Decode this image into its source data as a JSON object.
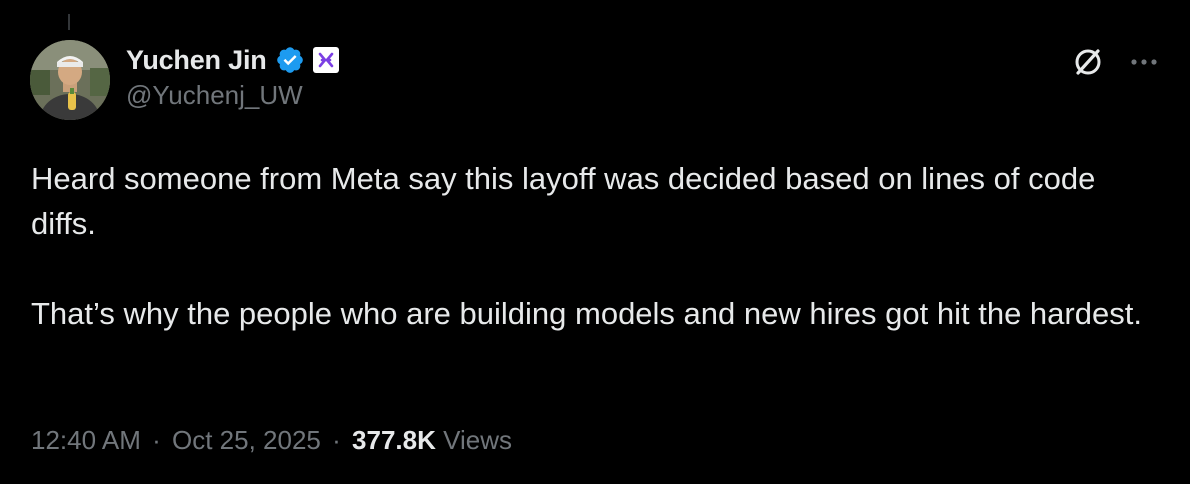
{
  "tweet": {
    "author": {
      "display_name": "Yuchen Jin",
      "handle": "@Yuchenj_UW",
      "verified": true,
      "verified_color": "#1d9bf0",
      "affiliate_badge_color": "#7b3fe4"
    },
    "paragraphs": [
      "Heard someone from Meta say this layoff was decided based on lines of code diffs.",
      "That’s why the people who are building models and new hires got hit the hardest."
    ],
    "time": "12:40 AM",
    "separator": "·",
    "date": "Oct 25, 2025",
    "views_count": "377.8K",
    "views_label": "Views"
  },
  "icons": {
    "avatar": "avatar",
    "verified": "verified-badge-icon",
    "affiliate": "affiliate-badge-icon",
    "grok": "grok-icon",
    "more": "more-icon"
  },
  "colors": {
    "background": "#000000",
    "text_primary": "#e7e9ea",
    "text_secondary": "#71767b",
    "accent": "#1d9bf0"
  }
}
